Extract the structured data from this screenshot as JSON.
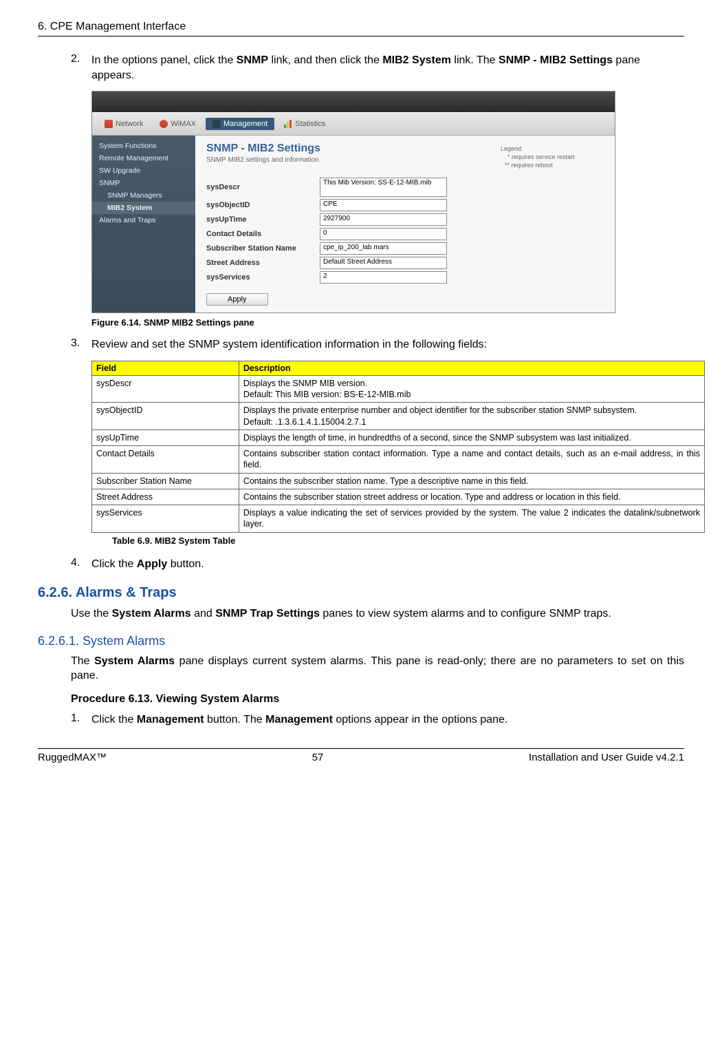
{
  "header": "6. CPE Management Interface",
  "steps": {
    "s2": {
      "num": "2.",
      "pre": "In the options panel, click the ",
      "b1": "SNMP",
      "mid1": " link, and then click the ",
      "b2": "MIB2 System",
      "mid2": " link. The ",
      "b3": "SNMP - MIB2 Settings",
      "post": " pane appears."
    },
    "s3": {
      "num": "3.",
      "text": "Review and set the SNMP system identification information in the following fields:"
    },
    "s4": {
      "num": "4.",
      "pre": "Click the ",
      "b1": "Apply",
      "post": " button."
    }
  },
  "figure_caption": "Figure 6.14. SNMP MIB2 Settings pane",
  "screenshot": {
    "nav": {
      "network": "Network",
      "wimax": "WiMAX",
      "management": "Management",
      "statistics": "Statistics"
    },
    "sidebar": {
      "items": [
        "System Functions",
        "Remote Management",
        "SW Upgrade",
        "SNMP",
        "SNMP Managers",
        "MIB2 System",
        "Alarms and Traps"
      ]
    },
    "main": {
      "title": "SNMP - MIB2 Settings",
      "subtitle": "SNMP MIB2 settings and information",
      "fields": [
        {
          "label": "sysDescr",
          "value": "This Mib Version: SS-E-12-MIB.mib"
        },
        {
          "label": "sysObjectID",
          "value": "CPE"
        },
        {
          "label": "sysUpTime",
          "value": "2927900"
        },
        {
          "label": "Contact Details",
          "value": "0"
        },
        {
          "label": "Subscriber Station Name",
          "value": "cpe_ip_200_lab mars"
        },
        {
          "label": "Street Address",
          "value": "Default Street Address"
        },
        {
          "label": "sysServices",
          "value": "2"
        }
      ],
      "apply": "Apply"
    },
    "legend": {
      "title": "Legend:",
      "l1": "* requires service restart",
      "l2": "** requires reboot"
    }
  },
  "table": {
    "headers": {
      "f": "Field",
      "d": "Description"
    },
    "rows": [
      {
        "f": "sysDescr",
        "d1": "Displays the SNMP MIB version.",
        "d2": "Default: This MIB version: BS-E-12-MIB.mib"
      },
      {
        "f": "sysObjectID",
        "d1": "Displays the private enterprise number and object identifier for the subscriber station SNMP subsystem.",
        "d2": "Default: .1.3.6.1.4.1.15004.2.7.1"
      },
      {
        "f": "sysUpTime",
        "d1": "Displays the length of time, in hundredths of a second, since the SNMP subsystem was last initialized."
      },
      {
        "f": "Contact Details",
        "d1": "Contains subscriber station contact information. Type a name and contact details, such as an e-mail address, in this field."
      },
      {
        "f": "Subscriber Station Name",
        "d1": "Contains the subscriber station name. Type a descriptive name in this field."
      },
      {
        "f": "Street Address",
        "d1": "Contains the subscriber station street address or location. Type and address or location in this field."
      },
      {
        "f": "sysServices",
        "d1": "Displays a value indicating the set of services provided by the system. The value 2 indicates the datalink/subnetwork layer."
      }
    ]
  },
  "table_caption": "Table 6.9. MIB2 System Table",
  "section_alarms": {
    "title": "6.2.6. Alarms & Traps",
    "p_pre": "Use the ",
    "b1": "System Alarms",
    "mid": " and ",
    "b2": "SNMP Trap Settings",
    "post": " panes to view system alarms and to configure SNMP traps."
  },
  "subsection_sysalarms": {
    "title": "6.2.6.1. System Alarms",
    "p_pre": "The ",
    "b1": "System Alarms",
    "post": " pane displays current system alarms. This pane is read-only; there are no parameters to set on this pane."
  },
  "procedure": {
    "title": "Procedure 6.13. Viewing System Alarms",
    "s1": {
      "num": "1.",
      "pre": "Click the ",
      "b1": "Management",
      "mid": " button. The ",
      "b2": "Management",
      "post": " options appear in the options pane."
    }
  },
  "footer": {
    "left": "RuggedMAX™",
    "center": "57",
    "right": "Installation and User Guide v4.2.1"
  }
}
